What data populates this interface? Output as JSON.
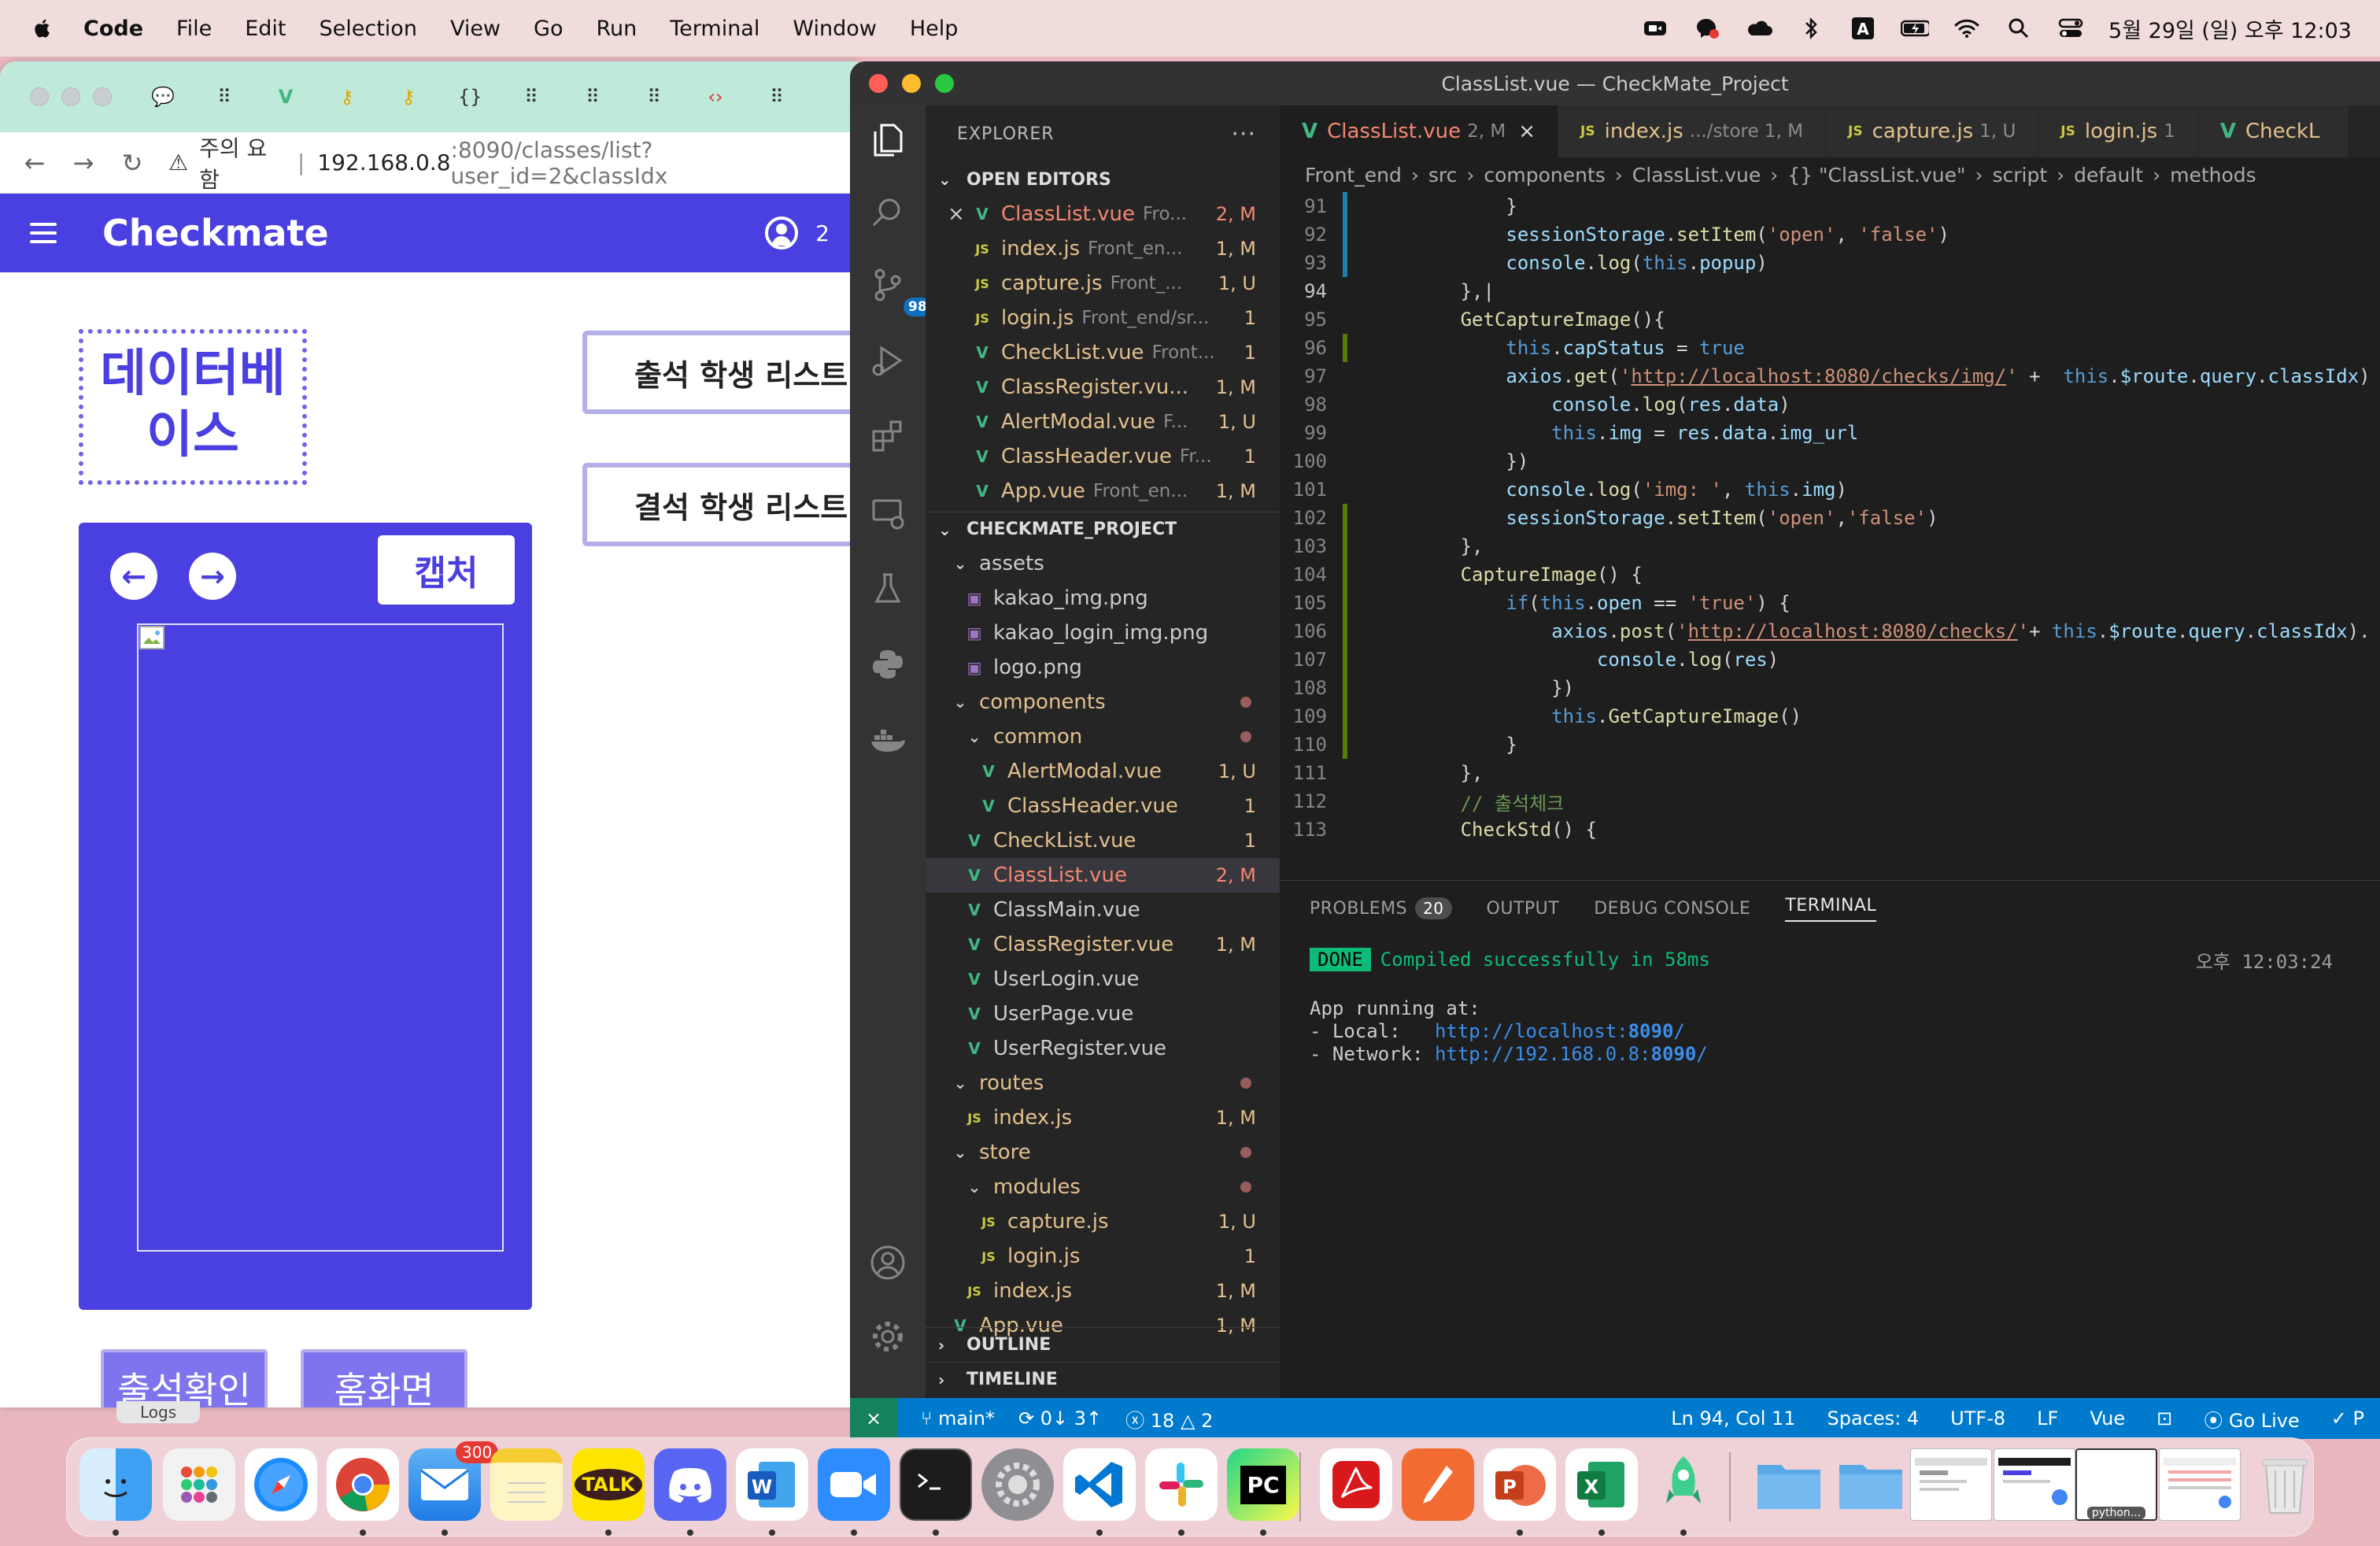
{
  "menubar": {
    "app": "Code",
    "items": [
      "File",
      "Edit",
      "Selection",
      "View",
      "Go",
      "Run",
      "Terminal",
      "Window",
      "Help"
    ],
    "datetime": "5월 29일 (일) 오후 12:03",
    "status_icons": [
      "zoom-icon",
      "messenger-icon",
      "cloud-icon",
      "bluetooth-icon",
      "input-source-icon",
      "battery-icon",
      "wifi-icon",
      "spotlight-icon",
      "control-center-icon"
    ]
  },
  "browser": {
    "tab_icons": [
      "chat-icon",
      "dots-icon",
      "vue-icon",
      "key-icon",
      "key-icon",
      "code-icon",
      "dots-icon",
      "dots-icon",
      "dots-icon",
      "code-icon",
      "dots-icon"
    ],
    "security_label": "주의 요함",
    "url_host": "192.168.0.8",
    "url_path": ":8090/classes/list?user_id=2&classIdx"
  },
  "checkmate": {
    "title": "Checkmate",
    "user_count": "2",
    "class_name_line1": "데이터베",
    "class_name_line2": "이스",
    "attend_list_btn": "출석 학생 리스트",
    "absent_list_btn": "결석 학생 리스트",
    "capture_btn": "캡처",
    "check_attendance_btn": "출석확인",
    "home_btn": "홈화면"
  },
  "logs_tab": "Logs",
  "vscode": {
    "window_title": "ClassList.vue — CheckMate_Project",
    "scm_badge": "98",
    "explorer_title": "EXPLORER",
    "open_editors_title": "OPEN EDITORS",
    "project_title": "CHECKMATE_PROJECT",
    "outline_title": "OUTLINE",
    "timeline_title": "TIMELINE",
    "open_editors": [
      {
        "name": "ClassList.vue",
        "dir": "Fro...",
        "status": "2, M",
        "type": "vue",
        "color": "err",
        "close": "×"
      },
      {
        "name": "index.js",
        "dir": "Front_en...",
        "status": "1, M",
        "type": "js",
        "color": "mod"
      },
      {
        "name": "capture.js",
        "dir": "Front_...",
        "status": "1, U",
        "type": "js",
        "color": "mod"
      },
      {
        "name": "login.js",
        "dir": "Front_end/sr...",
        "status": "1",
        "type": "js",
        "color": "mod"
      },
      {
        "name": "CheckList.vue",
        "dir": "Front...",
        "status": "1",
        "type": "vue",
        "color": "mod"
      },
      {
        "name": "ClassRegister.vu...",
        "dir": "",
        "status": "1, M",
        "type": "vue",
        "color": "mod"
      },
      {
        "name": "AlertModal.vue",
        "dir": "F...",
        "status": "1, U",
        "type": "vue",
        "color": "mod"
      },
      {
        "name": "ClassHeader.vue",
        "dir": "Fr...",
        "status": "1",
        "type": "vue",
        "color": "mod"
      },
      {
        "name": "App.vue",
        "dir": "Front_en...",
        "status": "1, M",
        "type": "vue",
        "color": "mod"
      }
    ],
    "tree": [
      {
        "name": "assets",
        "indent": 1,
        "type": "folder",
        "color": "norm"
      },
      {
        "name": "kakao_img.png",
        "indent": 2,
        "type": "png",
        "color": "norm"
      },
      {
        "name": "kakao_login_img.png",
        "indent": 2,
        "type": "png",
        "color": "norm"
      },
      {
        "name": "logo.png",
        "indent": 2,
        "type": "png",
        "color": "norm"
      },
      {
        "name": "components",
        "indent": 1,
        "type": "folder",
        "color": "mod",
        "dot": true
      },
      {
        "name": "common",
        "indent": 2,
        "type": "folder",
        "color": "mod",
        "dot": true
      },
      {
        "name": "AlertModal.vue",
        "indent": 3,
        "type": "vue",
        "color": "mod",
        "status": "1, U"
      },
      {
        "name": "ClassHeader.vue",
        "indent": 3,
        "type": "vue",
        "color": "mod",
        "status": "1"
      },
      {
        "name": "CheckList.vue",
        "indent": 2,
        "type": "vue",
        "color": "mod",
        "status": "1"
      },
      {
        "name": "ClassList.vue",
        "indent": 2,
        "type": "vue",
        "color": "err",
        "status": "2, M",
        "selected": true
      },
      {
        "name": "ClassMain.vue",
        "indent": 2,
        "type": "vue",
        "color": "norm"
      },
      {
        "name": "ClassRegister.vue",
        "indent": 2,
        "type": "vue",
        "color": "mod",
        "status": "1, M"
      },
      {
        "name": "UserLogin.vue",
        "indent": 2,
        "type": "vue",
        "color": "norm"
      },
      {
        "name": "UserPage.vue",
        "indent": 2,
        "type": "vue",
        "color": "norm"
      },
      {
        "name": "UserRegister.vue",
        "indent": 2,
        "type": "vue",
        "color": "norm"
      },
      {
        "name": "routes",
        "indent": 1,
        "type": "folder",
        "color": "mod",
        "dot": true
      },
      {
        "name": "index.js",
        "indent": 2,
        "type": "js",
        "color": "mod",
        "status": "1, M"
      },
      {
        "name": "store",
        "indent": 1,
        "type": "folder",
        "color": "mod",
        "dot": true
      },
      {
        "name": "modules",
        "indent": 2,
        "type": "folder",
        "color": "mod",
        "dot": true
      },
      {
        "name": "capture.js",
        "indent": 3,
        "type": "js",
        "color": "mod",
        "status": "1, U"
      },
      {
        "name": "login.js",
        "indent": 3,
        "type": "js",
        "color": "mod",
        "status": "1"
      },
      {
        "name": "index.js",
        "indent": 2,
        "type": "js",
        "color": "mod",
        "status": "1, M"
      },
      {
        "name": "App.vue",
        "indent": 1,
        "type": "vue",
        "color": "mod",
        "status": "1, M"
      }
    ],
    "tabs": [
      {
        "name": "ClassList.vue",
        "sub": "2, M",
        "type": "vue",
        "color": "err",
        "active": true,
        "close": "×"
      },
      {
        "name": "index.js",
        "sub": ".../store  1, M",
        "type": "js",
        "color": "mod"
      },
      {
        "name": "capture.js",
        "sub": "1, U",
        "type": "js",
        "color": "mod"
      },
      {
        "name": "login.js",
        "sub": "1",
        "type": "js",
        "color": "mod"
      },
      {
        "name": "CheckL",
        "sub": "",
        "type": "vue",
        "color": "mod"
      }
    ],
    "breadcrumbs": [
      "Front_end",
      "src",
      "components",
      "ClassList.vue",
      "{} \"ClassList.vue\"",
      "script",
      "default",
      "methods"
    ],
    "code_lines": [
      {
        "n": "91",
        "g": "b",
        "html": "            <span class=\"src\">}</span>"
      },
      {
        "n": "92",
        "g": "b",
        "html": "            <span class=\"id\">sessionStorage</span><span class=\"src\">.</span><span class=\"fn\">setItem</span><span class=\"src\">(</span><span class=\"str\">'open'</span><span class=\"src\">, </span><span class=\"str\">'false'</span><span class=\"src\">)</span>"
      },
      {
        "n": "93",
        "g": "b",
        "html": "            <span class=\"id\">console</span><span class=\"src\">.</span><span class=\"fn\">log</span><span class=\"src\">(</span><span class=\"kw\">this</span><span class=\"src\">.</span><span class=\"id\">popup</span><span class=\"src\">)</span>"
      },
      {
        "n": "94",
        "g": "",
        "cur": true,
        "html": "        <span class=\"src\">},|</span>"
      },
      {
        "n": "95",
        "g": "",
        "html": "        <span class=\"fn\">GetCaptureImage</span><span class=\"src\">(){</span>"
      },
      {
        "n": "96",
        "g": "g",
        "html": "            <span class=\"kw\">this</span><span class=\"src\">.</span><span class=\"id\">capStatus</span><span class=\"src\"> = </span><span class=\"kw\">true</span>"
      },
      {
        "n": "97",
        "g": "",
        "html": "            <span class=\"id\">axios</span><span class=\"src\">.</span><span class=\"fn\">get</span><span class=\"src\">(</span><span class=\"str\">'</span><span class=\"strl\">http://localhost:8080/checks/img/</span><span class=\"str\">'</span><span class=\"src\"> +  </span><span class=\"kw\">this</span><span class=\"src\">.</span><span class=\"id\">$route</span><span class=\"src\">.</span><span class=\"id\">query</span><span class=\"src\">.</span><span class=\"id\">classIdx</span><span class=\"src\">)</span>"
      },
      {
        "n": "98",
        "g": "",
        "html": "                <span class=\"id\">console</span><span class=\"src\">.</span><span class=\"fn\">log</span><span class=\"src\">(</span><span class=\"id\">res</span><span class=\"src\">.</span><span class=\"id\">data</span><span class=\"src\">)</span>"
      },
      {
        "n": "99",
        "g": "",
        "html": "                <span class=\"kw\">this</span><span class=\"src\">.</span><span class=\"id\">img</span><span class=\"src\"> = </span><span class=\"id\">res</span><span class=\"src\">.</span><span class=\"id\">data</span><span class=\"src\">.</span><span class=\"id\">img_url</span>"
      },
      {
        "n": "100",
        "g": "",
        "html": "            <span class=\"src\">})</span>"
      },
      {
        "n": "101",
        "g": "",
        "html": "            <span class=\"id\">console</span><span class=\"src\">.</span><span class=\"fn\">log</span><span class=\"src\">(</span><span class=\"str\">'img: '</span><span class=\"src\">, </span><span class=\"kw\">this</span><span class=\"src\">.</span><span class=\"id\">img</span><span class=\"src\">)</span>"
      },
      {
        "n": "102",
        "g": "g",
        "html": "            <span class=\"id\">sessionStorage</span><span class=\"src\">.</span><span class=\"fn\">setItem</span><span class=\"src\">(</span><span class=\"str\">'open'</span><span class=\"src\">,</span><span class=\"str\">'false'</span><span class=\"src\">)</span>"
      },
      {
        "n": "103",
        "g": "g",
        "html": "        <span class=\"src\">},</span>"
      },
      {
        "n": "104",
        "g": "g",
        "html": "        <span class=\"fn\">CaptureImage</span><span class=\"src\">() {</span>"
      },
      {
        "n": "105",
        "g": "g",
        "html": "            <span class=\"kw\">if</span><span class=\"src\">(</span><span class=\"kw\">this</span><span class=\"src\">.</span><span class=\"id\">open</span><span class=\"src\"> == </span><span class=\"str\">'true'</span><span class=\"src\">) {</span>"
      },
      {
        "n": "106",
        "g": "g",
        "html": "                <span class=\"id\">axios</span><span class=\"src\">.</span><span class=\"fn\">post</span><span class=\"src\">(</span><span class=\"str\">'</span><span class=\"strl\">http://localhost:8080/checks/</span><span class=\"str\">'</span><span class=\"src\">+ </span><span class=\"kw\">this</span><span class=\"src\">.</span><span class=\"id\">$route</span><span class=\"src\">.</span><span class=\"id\">query</span><span class=\"src\">.</span><span class=\"id\">classIdx</span><span class=\"src\">).</span>"
      },
      {
        "n": "107",
        "g": "g",
        "html": "                    <span class=\"id\">console</span><span class=\"src\">.</span><span class=\"fn\">log</span><span class=\"src\">(</span><span class=\"id\">res</span><span class=\"src\">)</span>"
      },
      {
        "n": "108",
        "g": "g",
        "html": "                <span class=\"src\">})</span>"
      },
      {
        "n": "109",
        "g": "g",
        "html": "                <span class=\"kw\">this</span><span class=\"src\">.</span><span class=\"fn\">GetCaptureImage</span><span class=\"src\">()</span>"
      },
      {
        "n": "110",
        "g": "g",
        "html": "            <span class=\"src\">}</span>"
      },
      {
        "n": "111",
        "g": "",
        "html": "        <span class=\"src\">},</span>"
      },
      {
        "n": "112",
        "g": "",
        "html": "        <span class=\"cm\">// 출석체크</span>"
      },
      {
        "n": "113",
        "g": "",
        "html": "        <span class=\"fn\">CheckStd</span><span class=\"src\">() {</span>"
      }
    ],
    "panel_tabs": {
      "problems": "PROBLEMS",
      "problems_count": "20",
      "output": "OUTPUT",
      "debug": "DEBUG CONSOLE",
      "terminal": "TERMINAL"
    },
    "terminal": {
      "done": "DONE",
      "compiled": "Compiled successfully in 58ms",
      "time": "오후 12:03:24",
      "running": "App running at:",
      "local_label": "- Local:   ",
      "local_prefix": "http://localhost:",
      "local_port": "8090",
      "local_suffix": "/",
      "network_label": "- Network: ",
      "network_prefix": "http://192.168.0.8:",
      "network_port": "8090",
      "network_suffix": "/"
    },
    "status": {
      "branch": "main*",
      "sync": "0↓ 3↑",
      "errors": "18",
      "warnings": "2",
      "position": "Ln 94, Col 11",
      "spaces": "Spaces: 4",
      "encoding": "UTF-8",
      "eol": "LF",
      "language": "Vue",
      "golive": "Go Live",
      "prettier": "P"
    }
  },
  "dock": {
    "mail_badge": "300",
    "kakao_label": "TALK",
    "pycharm_label": "PC",
    "preview_label": "python..."
  }
}
